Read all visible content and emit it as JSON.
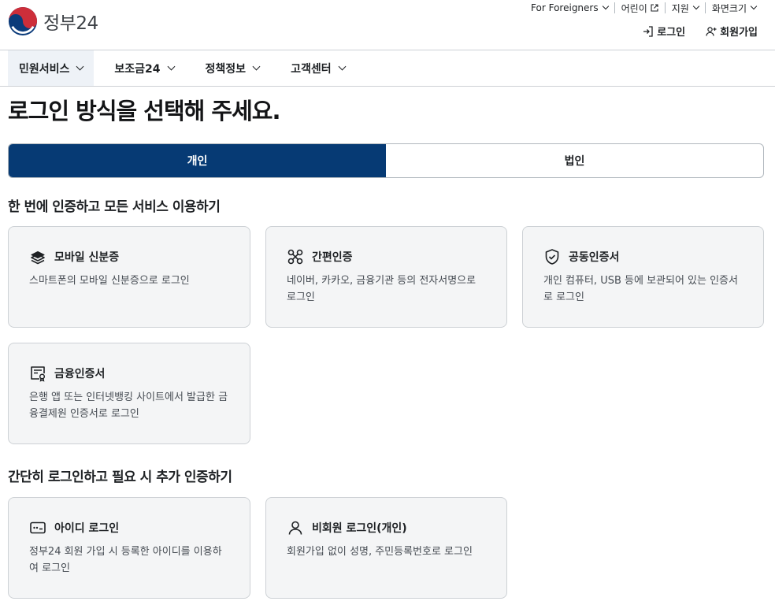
{
  "header": {
    "logo_text": "정부24",
    "utility": [
      {
        "label": "For Foreigners"
      },
      {
        "label": "어린이"
      },
      {
        "label": "지원"
      },
      {
        "label": "화면크기"
      }
    ],
    "login_label": "로그인",
    "signup_label": "회원가입"
  },
  "nav": {
    "items": [
      {
        "label": "민원서비스"
      },
      {
        "label": "보조금24"
      },
      {
        "label": "정책정보"
      },
      {
        "label": "고객센터"
      }
    ]
  },
  "page": {
    "title": "로그인 방식을 선택해 주세요.",
    "tabs": [
      {
        "label": "개인"
      },
      {
        "label": "법인"
      }
    ]
  },
  "sections": [
    {
      "title": "한 번에 인증하고 모든 서비스 이용하기",
      "cards": [
        {
          "title": "모바일 신분증",
          "desc": "스마트폰의 모바일 신분증으로 로그인",
          "icon": "mobile-id-icon"
        },
        {
          "title": "간편인증",
          "desc": "네이버, 카카오, 금융기관 등의 전자서명으로 로그인",
          "icon": "simple-auth-icon"
        },
        {
          "title": "공동인증서",
          "desc": "개인 컴퓨터, USB 등에 보관되어 있는 인증서로 로그인",
          "icon": "shield-check-icon"
        },
        {
          "title": "금융인증서",
          "desc": "은행 앱 또는 인터넷뱅킹 사이트에서 발급한 금융결제원 인증서로 로그인",
          "icon": "certificate-icon"
        }
      ]
    },
    {
      "title": "간단히 로그인하고 필요 시 추가 인증하기",
      "cards": [
        {
          "title": "아이디 로그인",
          "desc": "정부24 회원 가입 시 등록한 아이디를 이용하여 로그인",
          "icon": "id-password-icon"
        },
        {
          "title": "비회원 로그인(개인)",
          "desc": "회원가입 없이 성명, 주민등록번호로 로그인",
          "icon": "user-icon"
        }
      ]
    }
  ],
  "colors": {
    "primary": "#063a74",
    "card_bg": "#f4f5f6",
    "border": "#cdd1d5"
  }
}
